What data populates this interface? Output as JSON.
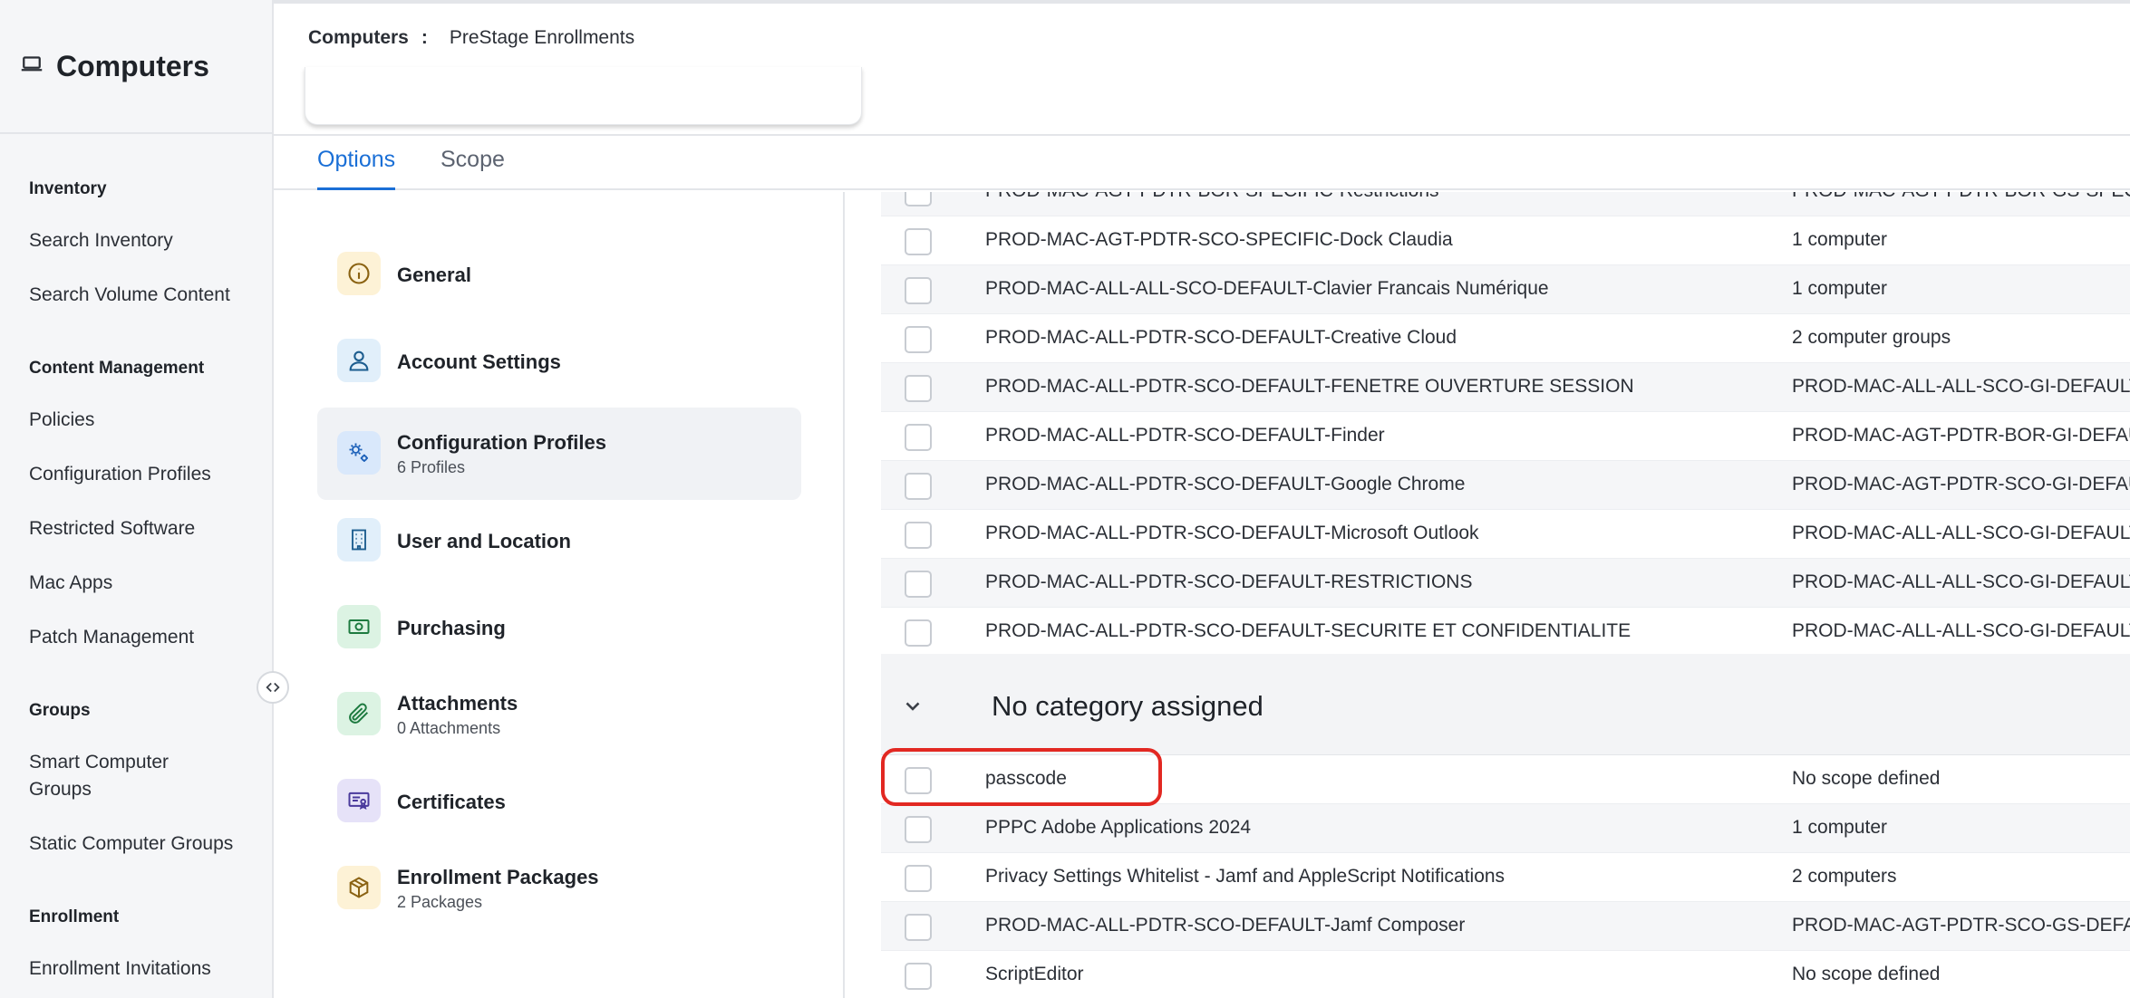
{
  "sidebar": {
    "title": "Computers",
    "sections": [
      {
        "heading": "Inventory",
        "items": [
          "Search Inventory",
          "Search Volume Content"
        ]
      },
      {
        "heading": "Content Management",
        "items": [
          "Policies",
          "Configuration Profiles",
          "Restricted Software",
          "Mac Apps",
          "Patch Management"
        ]
      },
      {
        "heading": "Groups",
        "items": [
          "Smart Computer Groups",
          "Static Computer Groups"
        ]
      },
      {
        "heading": "Enrollment",
        "items": [
          "Enrollment Invitations"
        ]
      }
    ]
  },
  "breadcrumb": {
    "root": "Computers",
    "separator": ":",
    "current": "PreStage Enrollments"
  },
  "tabs": [
    {
      "label": "Options",
      "active": true
    },
    {
      "label": "Scope",
      "active": false
    }
  ],
  "options": [
    {
      "label": "General",
      "sublabel": "",
      "icon": "info-icon",
      "active": false
    },
    {
      "label": "Account Settings",
      "sublabel": "",
      "icon": "user-icon",
      "active": false
    },
    {
      "label": "Configuration Profiles",
      "sublabel": "6 Profiles",
      "icon": "gears-icon",
      "active": true
    },
    {
      "label": "User and Location",
      "sublabel": "",
      "icon": "building-icon",
      "active": false
    },
    {
      "label": "Purchasing",
      "sublabel": "",
      "icon": "money-icon",
      "active": false
    },
    {
      "label": "Attachments",
      "sublabel": "0 Attachments",
      "icon": "paperclip-icon",
      "active": false
    },
    {
      "label": "Certificates",
      "sublabel": "",
      "icon": "certificate-icon",
      "active": false
    },
    {
      "label": "Enrollment Packages",
      "sublabel": "2 Packages",
      "icon": "package-icon",
      "active": false
    }
  ],
  "profiles_top": [
    {
      "name": "PROD-MAC-AGT-PDTR-BOR-SPECIFIC-Restrictions",
      "scope": "PROD-MAC-AGT-PDTR-BOR-GS-SPECIFIC"
    },
    {
      "name": "PROD-MAC-AGT-PDTR-SCO-SPECIFIC-Dock Claudia",
      "scope": "1 computer"
    },
    {
      "name": "PROD-MAC-ALL-ALL-SCO-DEFAULT-Clavier Francais Numérique",
      "scope": "1 computer"
    },
    {
      "name": "PROD-MAC-ALL-PDTR-SCO-DEFAULT-Creative Cloud",
      "scope": "2 computer groups"
    },
    {
      "name": "PROD-MAC-ALL-PDTR-SCO-DEFAULT-FENETRE OUVERTURE SESSION",
      "scope": "PROD-MAC-ALL-ALL-SCO-GI-DEFAULT"
    },
    {
      "name": "PROD-MAC-ALL-PDTR-SCO-DEFAULT-Finder",
      "scope": "PROD-MAC-AGT-PDTR-BOR-GI-DEFAULT"
    },
    {
      "name": "PROD-MAC-ALL-PDTR-SCO-DEFAULT-Google Chrome",
      "scope": "PROD-MAC-AGT-PDTR-SCO-GI-DEFAULT"
    },
    {
      "name": "PROD-MAC-ALL-PDTR-SCO-DEFAULT-Microsoft Outlook",
      "scope": "PROD-MAC-ALL-ALL-SCO-GI-DEFAULT"
    },
    {
      "name": "PROD-MAC-ALL-PDTR-SCO-DEFAULT-RESTRICTIONS",
      "scope": "PROD-MAC-ALL-ALL-SCO-GI-DEFAULT"
    },
    {
      "name": "PROD-MAC-ALL-PDTR-SCO-DEFAULT-SECURITE ET CONFIDENTIALITE",
      "scope": "PROD-MAC-ALL-ALL-SCO-GI-DEFAULT"
    }
  ],
  "group": {
    "title": "No category assigned"
  },
  "profiles_bottom": [
    {
      "name": "passcode",
      "scope": "No scope defined"
    },
    {
      "name": "PPPC Adobe Applications 2024",
      "scope": "1 computer"
    },
    {
      "name": "Privacy Settings Whitelist - Jamf and AppleScript Notifications",
      "scope": "2 computers"
    },
    {
      "name": "PROD-MAC-ALL-PDTR-SCO-DEFAULT-Jamf Composer",
      "scope": "PROD-MAC-AGT-PDTR-SCO-GS-DEFAULT"
    },
    {
      "name": "ScriptEditor",
      "scope": "No scope defined"
    }
  ],
  "colors": {
    "accent": "#1a6fd6",
    "highlight": "#e22822"
  }
}
